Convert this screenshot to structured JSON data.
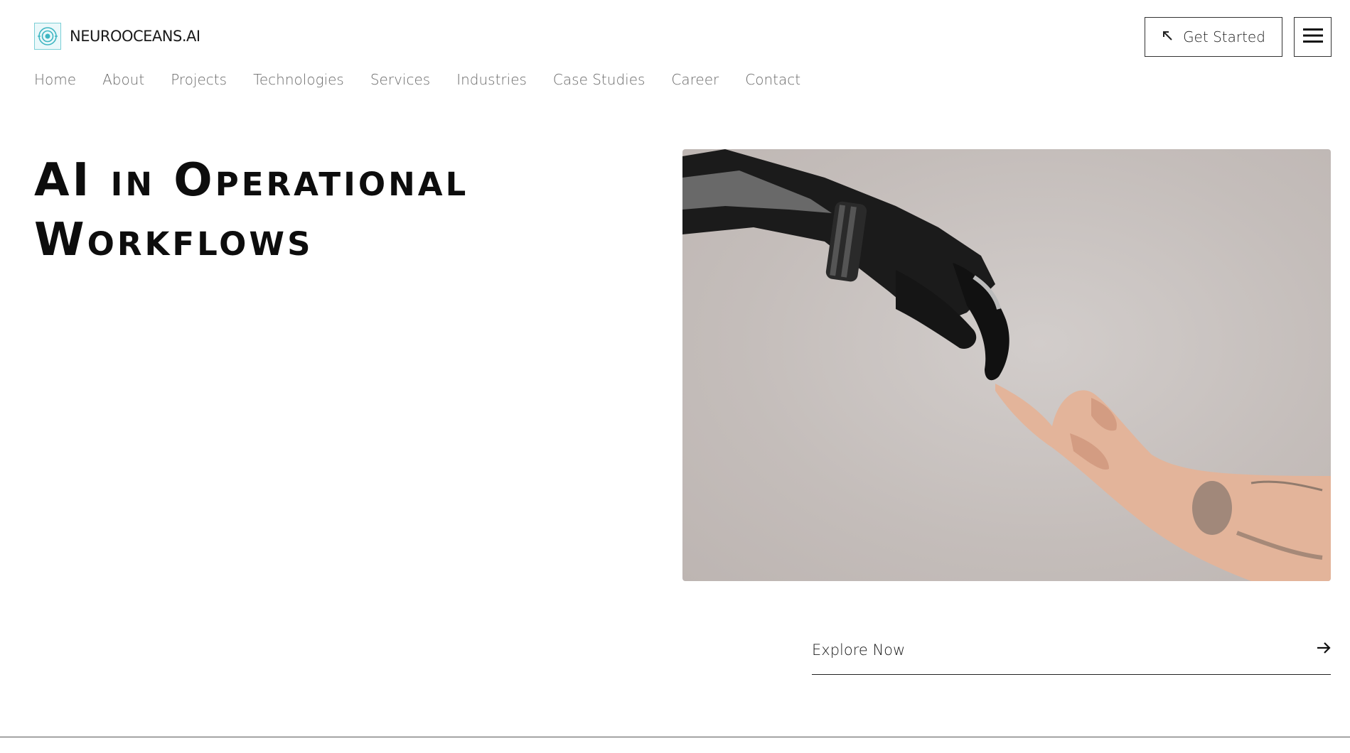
{
  "brand": {
    "name": "NEUROOCEANS.AI",
    "logo_icon": "neural-eye-logo-icon",
    "accent_color": "#3fb6c2"
  },
  "nav": {
    "items": [
      {
        "label": "Home"
      },
      {
        "label": "About"
      },
      {
        "label": "Projects"
      },
      {
        "label": "Technologies"
      },
      {
        "label": "Services"
      },
      {
        "label": "Industries"
      },
      {
        "label": "Case Studies"
      },
      {
        "label": "Career"
      },
      {
        "label": "Contact"
      }
    ]
  },
  "header": {
    "cta_label": "Get Started",
    "cta_icon": "arrow-up-left-icon",
    "menu_icon": "hamburger-menu-icon"
  },
  "hero": {
    "title_line1": "AI in Operational",
    "title_line2": "Workflows",
    "image_icon": "robot-human-hand-image",
    "explore_label": "Explore Now",
    "explore_icon": "arrow-right-icon"
  }
}
